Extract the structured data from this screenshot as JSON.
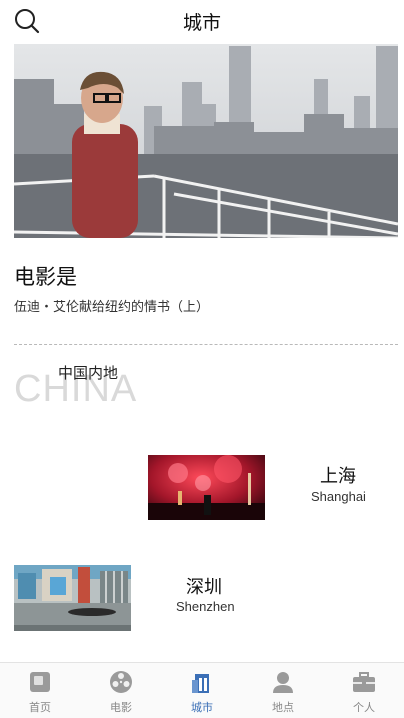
{
  "header": {
    "title": "城市"
  },
  "feature": {
    "title": "电影是",
    "subtitle": "伍迪・艾伦献给纽约的情书（上）"
  },
  "region": {
    "name_en": "CHINA",
    "name_cn": "中国内地"
  },
  "cities": [
    {
      "name_cn": "上海",
      "name_en": "Shanghai"
    },
    {
      "name_cn": "深圳",
      "name_en": "Shenzhen"
    }
  ],
  "nav": {
    "items": [
      {
        "label": "首页",
        "icon": "home-icon"
      },
      {
        "label": "电影",
        "icon": "film-reel-icon"
      },
      {
        "label": "城市",
        "icon": "city-icon",
        "active": true
      },
      {
        "label": "地点",
        "icon": "person-pin-icon"
      },
      {
        "label": "个人",
        "icon": "briefcase-icon"
      }
    ],
    "active_color": "#3b6fb6",
    "inactive_color": "#888888"
  }
}
